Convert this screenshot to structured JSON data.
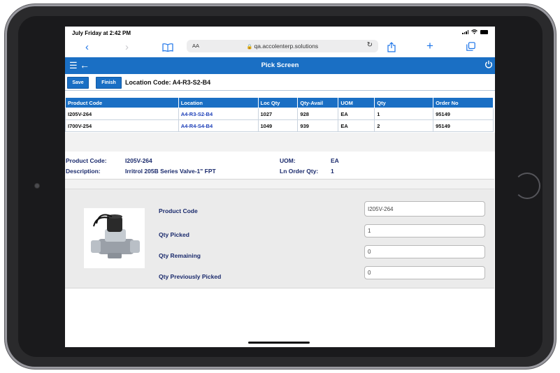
{
  "status": {
    "time": "July Friday at 2:42 PM"
  },
  "browser": {
    "text_size_label": "AA",
    "url": "qa.accolenterp.solutions"
  },
  "app": {
    "title": "Pick Screen",
    "accent": "#1a6fc4"
  },
  "toolbar": {
    "save_label": "Save",
    "finish_label": "Finish",
    "location_code_label": "Location Code: A4-R3-S2-B4"
  },
  "table": {
    "headers": [
      "Product Code",
      "Location",
      "Loc Qty",
      "Qty-Avail",
      "UOM",
      "Qty",
      "Order No"
    ],
    "rows": [
      [
        "I205V-264",
        "A4-R3-S2-B4",
        "1027",
        "928",
        "EA",
        "1",
        "95149"
      ],
      [
        "I700V-254",
        "A4-R4-S4-B4",
        "1049",
        "939",
        "EA",
        "2",
        "95149"
      ]
    ]
  },
  "details": {
    "product_code_label": "Product Code:",
    "product_code_value": "I205V-264",
    "description_label": "Description:",
    "description_value": "Irritrol 205B Series Valve-1\" FPT",
    "uom_label": "UOM:",
    "uom_value": "EA",
    "ln_order_qty_label": "Ln Order Qty:",
    "ln_order_qty_value": "1"
  },
  "form": {
    "product_code_label": "Product Code",
    "product_code_value": "I205V-264",
    "qty_picked_label": "Qty Picked",
    "qty_picked_value": "1",
    "qty_remaining_label": "Qty Remaining",
    "qty_remaining_value": "0",
    "qty_prev_label": "Qty Previously Picked",
    "qty_prev_value": "0"
  }
}
